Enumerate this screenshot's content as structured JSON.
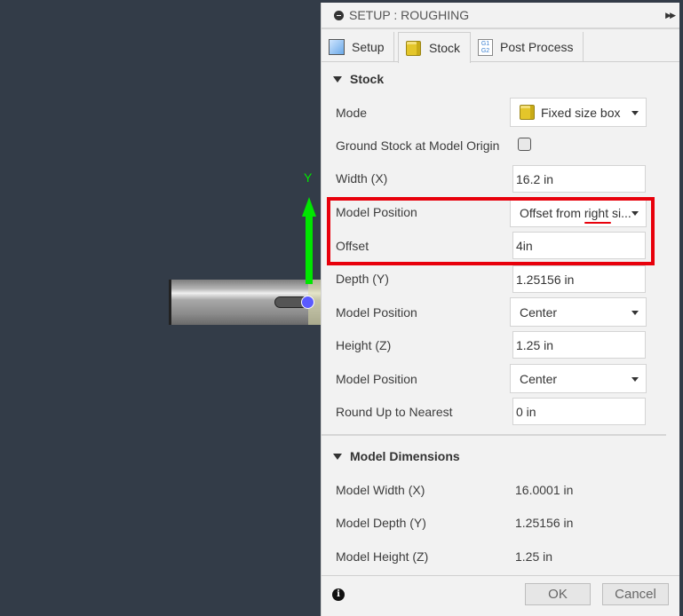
{
  "viewport": {
    "axis_label": "Y",
    "axis_color": "#00e600"
  },
  "panel": {
    "title": "SETUP : ROUGHING",
    "tabs": [
      {
        "label": "Setup"
      },
      {
        "label": "Stock"
      },
      {
        "label": "Post Process"
      }
    ],
    "g_icon": "G1 G2",
    "stock_section": "Stock",
    "rows": {
      "mode_label": "Mode",
      "mode_value": "Fixed size box",
      "ground_label": "Ground Stock at Model Origin",
      "ground_checked": false,
      "width_label": "Width (X)",
      "width_value": "16.2 in",
      "mp1_label": "Model Position",
      "mp1_value": "Offset from right si...",
      "offset_label": "Offset",
      "offset_value": "4in",
      "depth_label": "Depth (Y)",
      "depth_value": "1.25156 in",
      "mp2_label": "Model Position",
      "mp2_value": "Center",
      "height_label": "Height (Z)",
      "height_value": "1.25 in",
      "mp3_label": "Model Position",
      "mp3_value": "Center",
      "round_label": "Round Up to Nearest",
      "round_value": "0 in"
    },
    "dims_section": "Model Dimensions",
    "dims": [
      {
        "label": "Model Width (X)",
        "value": "16.0001 in"
      },
      {
        "label": "Model Depth (Y)",
        "value": "1.25156 in"
      },
      {
        "label": "Model Height (Z)",
        "value": "1.25 in"
      }
    ],
    "ok": "OK",
    "cancel": "Cancel",
    "highlight_color": "#e8000b"
  }
}
